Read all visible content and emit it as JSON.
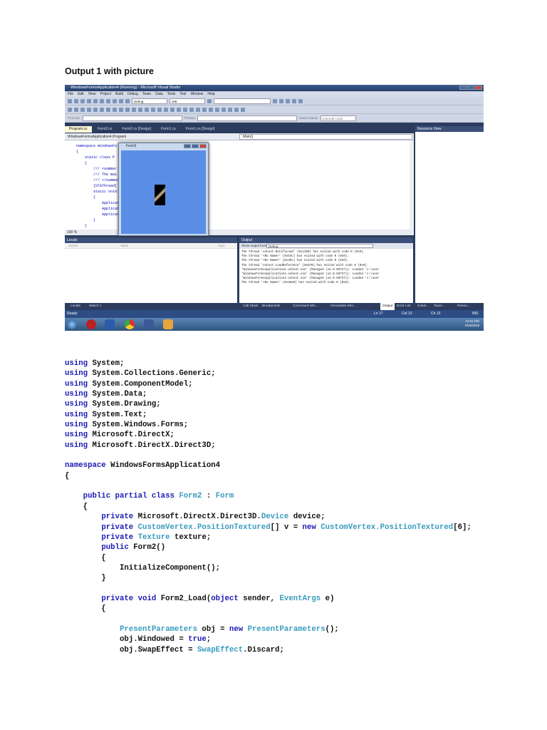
{
  "heading": "Output 1 with picture",
  "screenshot": {
    "title": "WindowsFormsApplication4 (Running) - Microsoft Visual Studio",
    "menu": [
      "File",
      "Edit",
      "View",
      "Project",
      "Build",
      "Debug",
      "Team",
      "Data",
      "Tools",
      "Test",
      "Window",
      "Help"
    ],
    "config": "Debug",
    "platform": "x86",
    "process_label": "Process:",
    "thread_label": "Thread:",
    "stack_label": "Stack Frame:",
    "stack_value": "External Code",
    "tabs": [
      "Program.cs",
      "Form2.cs",
      "Form2.cs [Design]",
      "Form1.cs",
      "Form1.cs [Design]"
    ],
    "nav_left": "WindowsFormsApplication4.Program",
    "nav_right": "Main()",
    "editor_lines": [
      "namespace WindowsFo",
      "{",
      "    static class P",
      "    {",
      "        /// <summar",
      "        /// The mai",
      "        /// </summar",
      "        [STAThread]",
      "        static void",
      "        {",
      "            Applicati",
      "            Applicati",
      "            Applicati                               m());",
      "        }",
      "    }",
      "}"
    ],
    "zoom": "100 %",
    "form_title": "Form2",
    "resource_view": "Resource View",
    "locals": {
      "title": "Locals",
      "cols": [
        "Name",
        "Value",
        "Type"
      ]
    },
    "output": {
      "title": "Output",
      "show_from": "Show output from:",
      "source": "Debug",
      "lines": [
        "The thread 'vshost.NotifyLoad' (0x1350) has exited with code 0 (0x0).",
        "The thread '<No Name>' (0xb4c) has exited with code 0 (0x0).",
        "The thread '<No Name>' (0x3bc) has exited with code 0 (0x0).",
        "The thread 'vshost.LoadReference' (0x670) has exited with code 0 (0x0).",
        "'WindowsFormsApplication4.vshost.exe' (Managed (v2.0.50727)): Loaded 'c:\\user",
        "'WindowsFormsApplication4.vshost.exe' (Managed (v2.0.50727)): Loaded 'c:\\user",
        "'WindowsFormsApplication4.vshost.exe' (Managed (v2.0.50727)): Loaded 'c:\\user",
        "The thread '<No Name>' (0x28e0) has exited with code 0 (0x0)."
      ]
    },
    "bottom_tabs": [
      "Locals",
      "Watch 1",
      "Call Stack",
      "Breakpoints",
      "Command Win...",
      "Immediate Win...",
      "Output",
      "Error List",
      "Soluti...",
      "Team...",
      "Resou..."
    ],
    "status": {
      "ready": "Ready",
      "ln": "Ln 17",
      "col": "Col 13",
      "ch": "Ch 13",
      "ins": "INS"
    },
    "clock": {
      "time": "12:51 PM",
      "date": "9/18/2019"
    }
  },
  "code": [
    [
      [
        "kw",
        "using"
      ],
      [
        "",
        "System;"
      ]
    ],
    [
      [
        "kw",
        "using"
      ],
      [
        "",
        "System.Collections.Generic;"
      ]
    ],
    [
      [
        "kw",
        "using"
      ],
      [
        "",
        "System.ComponentModel;"
      ]
    ],
    [
      [
        "kw",
        "using"
      ],
      [
        "",
        "System.Data;"
      ]
    ],
    [
      [
        "kw",
        "using"
      ],
      [
        "",
        "System.Drawing;"
      ]
    ],
    [
      [
        "kw",
        "using"
      ],
      [
        "",
        "System.Text;"
      ]
    ],
    [
      [
        "kw",
        "using"
      ],
      [
        "",
        "System.Windows.Forms;"
      ]
    ],
    [
      [
        "kw",
        "using"
      ],
      [
        "",
        "Microsoft.DirectX;"
      ]
    ],
    [
      [
        "kw",
        "using"
      ],
      [
        "",
        "Microsoft.DirectX.Direct3D;"
      ]
    ],
    [],
    [
      [
        "kw",
        "namespace"
      ],
      [
        "",
        "WindowsFormsApplication4"
      ]
    ],
    [
      [
        "",
        "{"
      ]
    ],
    [],
    [
      [
        "",
        "    "
      ],
      [
        "kw",
        "public partial class"
      ],
      [
        "ty",
        "Form2"
      ],
      [
        "",
        " :"
      ],
      [
        "ty",
        "Form"
      ]
    ],
    [
      [
        "",
        "    {"
      ]
    ],
    [
      [
        "",
        "        "
      ],
      [
        "kw",
        "private"
      ],
      [
        "",
        "Microsoft.DirectX.Direct3D."
      ],
      [
        "ty",
        "Device"
      ],
      [
        "",
        "device;"
      ]
    ],
    [
      [
        "",
        "        "
      ],
      [
        "kw",
        "private"
      ],
      [
        "ty",
        "CustomVertex.PositionTextured"
      ],
      [
        "",
        "[] v = "
      ],
      [
        "kw",
        "new"
      ],
      [
        "ty",
        "CustomVertex.PositionTextured"
      ],
      [
        "",
        "[6];"
      ]
    ],
    [
      [
        "",
        "        "
      ],
      [
        "kw",
        "private"
      ],
      [
        "ty",
        "Texture"
      ],
      [
        "",
        "texture;"
      ]
    ],
    [
      [
        "",
        "        "
      ],
      [
        "kw",
        "public"
      ],
      [
        "",
        "Form2()"
      ]
    ],
    [
      [
        "",
        "        {"
      ]
    ],
    [
      [
        "",
        "            InitializeComponent();"
      ]
    ],
    [
      [
        "",
        "        }"
      ]
    ],
    [],
    [
      [
        "",
        "        "
      ],
      [
        "kw",
        "private void"
      ],
      [
        "",
        "Form2_Load("
      ],
      [
        "kw",
        "object"
      ],
      [
        "",
        "sender,"
      ],
      [
        "ty",
        "EventArgs"
      ],
      [
        "",
        "e)"
      ]
    ],
    [
      [
        "",
        "        {"
      ]
    ],
    [],
    [
      [
        "",
        "            "
      ],
      [
        "ty",
        "PresentParameters"
      ],
      [
        "",
        "obj = "
      ],
      [
        "kw",
        "new"
      ],
      [
        "ty",
        "PresentParameters"
      ],
      [
        "",
        "();"
      ]
    ],
    [
      [
        "",
        "            obj.Windowed = "
      ],
      [
        "kw",
        "true"
      ],
      [
        "",
        ";"
      ]
    ],
    [
      [
        "",
        "            obj.SwapEffect = "
      ],
      [
        "ty",
        "SwapEffect"
      ],
      [
        "",
        ".Discard;"
      ]
    ]
  ]
}
